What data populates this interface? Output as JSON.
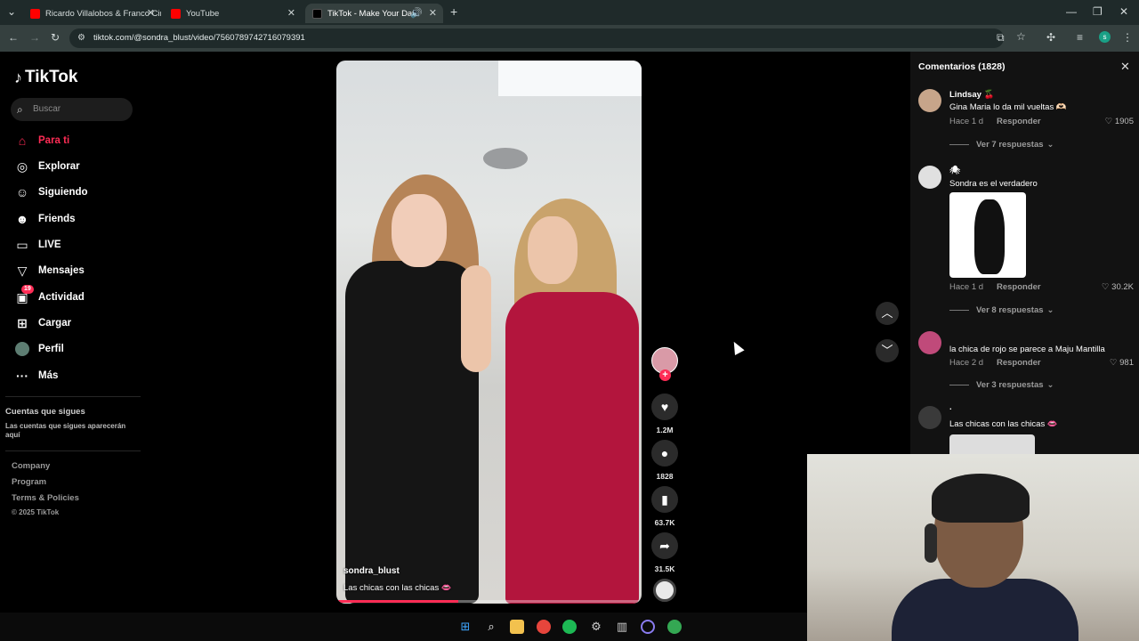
{
  "browser": {
    "tabs": [
      {
        "title": "Ricardo Villalobos & Franco Cin",
        "icon": "youtube-icon"
      },
      {
        "title": "YouTube",
        "icon": "youtube-icon"
      },
      {
        "title": "TikTok - Make Your Day",
        "icon": "tiktok-icon"
      }
    ],
    "url": "tiktok.com/@sondra_blust/video/7560789742716079391"
  },
  "sidebar": {
    "logo": "TikTok",
    "search_placeholder": "Buscar",
    "items": [
      {
        "label": "Para ti",
        "icon": "home-icon",
        "glyph": "⌂"
      },
      {
        "label": "Explorar",
        "icon": "compass-icon",
        "glyph": "◎"
      },
      {
        "label": "Siguiendo",
        "icon": "following-icon",
        "glyph": "☺"
      },
      {
        "label": "Friends",
        "icon": "friends-icon",
        "glyph": "☻"
      },
      {
        "label": "LIVE",
        "icon": "live-icon",
        "glyph": "▭"
      },
      {
        "label": "Mensajes",
        "icon": "messages-icon",
        "glyph": "▽"
      },
      {
        "label": "Actividad",
        "icon": "activity-icon",
        "glyph": "▣",
        "badge": "19"
      },
      {
        "label": "Cargar",
        "icon": "upload-icon",
        "glyph": "⊞"
      },
      {
        "label": "Perfil",
        "icon": "profile-icon",
        "glyph": "●"
      },
      {
        "label": "Más",
        "icon": "more-icon",
        "glyph": "···"
      }
    ],
    "following_heading": "Cuentas que sigues",
    "following_hint": "Las cuentas que sigues aparecerán aquí",
    "footer": [
      "Company",
      "Program",
      "Terms & Policies",
      "© 2025 TikTok"
    ]
  },
  "video": {
    "username": "sondra_blust",
    "caption": "Las chicas con las chicas 👄",
    "progress": 0.4
  },
  "actions": {
    "likes": "1.2M",
    "comments": "1828",
    "saves": "63.7K",
    "shares": "31.5K"
  },
  "comments_panel": {
    "title": "Comentarios (1828)",
    "items": [
      {
        "name": "Lindsay 🍒",
        "text": "Gina Maria lo da mil vueltas 🫶🏻",
        "time": "Hace 1 d",
        "reply": "Responder",
        "likes": "1905",
        "more": "Ver 7 respuestas"
      },
      {
        "name": "🕷",
        "text": "Sondra es el verdadero",
        "time": "Hace 1 d",
        "reply": "Responder",
        "likes": "30.2K",
        "more": "Ver 8 respuestas"
      },
      {
        "name": "",
        "text": "la chica de rojo se parece a Maju Mantilla",
        "time": "Hace 2 d",
        "reply": "Responder",
        "likes": "981",
        "more": "Ver 3 respuestas"
      },
      {
        "name": ".",
        "text": "Las chicas con las chicas 👄",
        "time": "",
        "reply": "",
        "likes": "",
        "more": ""
      }
    ]
  },
  "colors": {
    "accent": "#fe2c55",
    "background": "#000000",
    "panel": "#121212"
  }
}
